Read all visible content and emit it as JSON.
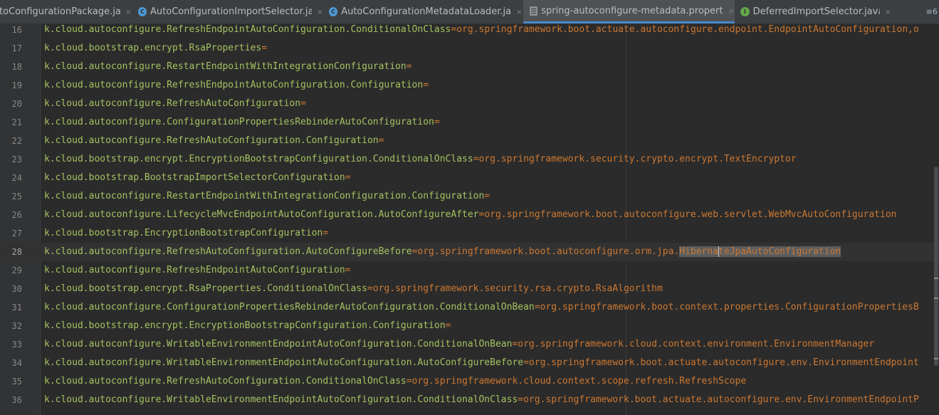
{
  "tabs": [
    {
      "label": "toConfigurationPackage.java",
      "icon": "none",
      "active": false
    },
    {
      "label": "AutoConfigurationImportSelector.java",
      "icon": "class-icon",
      "active": false
    },
    {
      "label": "AutoConfigurationMetadataLoader.java",
      "icon": "class-icon",
      "active": false
    },
    {
      "label": "spring-autoconfigure-metadata.properties",
      "icon": "properties-file-icon",
      "active": true
    },
    {
      "label": "DeferredImportSelector.java",
      "icon": "interface-icon",
      "active": false
    }
  ],
  "tab_close_glyph": "×",
  "tab_overflow_glyph": "≡6",
  "colors": {
    "background": "#2b2b2b",
    "key": "#a5c261",
    "value": "#cc7832",
    "line_number": "#888888",
    "active_tab_underline": "#4a88c7"
  },
  "editor": {
    "current_line": 28,
    "lines": [
      {
        "num": "16",
        "key": "k.cloud.autoconfigure.RefreshEndpointAutoConfiguration.ConditionalOnClass",
        "value": "org.springframework.boot.actuate.autoconfigure.endpoint.EndpointAutoConfiguration,o"
      },
      {
        "num": "17",
        "key": "k.cloud.bootstrap.encrypt.RsaProperties",
        "value": ""
      },
      {
        "num": "18",
        "key": "k.cloud.autoconfigure.RestartEndpointWithIntegrationConfiguration",
        "value": ""
      },
      {
        "num": "19",
        "key": "k.cloud.autoconfigure.RefreshEndpointAutoConfiguration.Configuration",
        "value": ""
      },
      {
        "num": "20",
        "key": "k.cloud.autoconfigure.RefreshAutoConfiguration",
        "value": ""
      },
      {
        "num": "21",
        "key": "k.cloud.autoconfigure.ConfigurationPropertiesRebinderAutoConfiguration",
        "value": ""
      },
      {
        "num": "22",
        "key": "k.cloud.autoconfigure.RefreshAutoConfiguration.Configuration",
        "value": ""
      },
      {
        "num": "23",
        "key": "k.cloud.bootstrap.encrypt.EncryptionBootstrapConfiguration.ConditionalOnClass",
        "value": "org.springframework.security.crypto.encrypt.TextEncryptor"
      },
      {
        "num": "24",
        "key": "k.cloud.bootstrap.BootstrapImportSelectorConfiguration",
        "value": ""
      },
      {
        "num": "25",
        "key": "k.cloud.autoconfigure.RestartEndpointWithIntegrationConfiguration.Configuration",
        "value": ""
      },
      {
        "num": "26",
        "key": "k.cloud.autoconfigure.LifecycleMvcEndpointAutoConfiguration.AutoConfigureAfter",
        "value": "org.springframework.boot.autoconfigure.web.servlet.WebMvcAutoConfiguration"
      },
      {
        "num": "27",
        "key": "k.cloud.bootstrap.EncryptionBootstrapConfiguration",
        "value": ""
      },
      {
        "num": "28",
        "key": "k.cloud.autoconfigure.RefreshAutoConfiguration.AutoConfigureBefore",
        "value": "org.springframework.boot.autoconfigure.orm.jpa.",
        "sel_before": "Hiberna",
        "sel_after": "teJpaAutoConfiguration"
      },
      {
        "num": "29",
        "key": "k.cloud.autoconfigure.RefreshEndpointAutoConfiguration",
        "value": ""
      },
      {
        "num": "30",
        "key": "k.cloud.bootstrap.encrypt.RsaProperties.ConditionalOnClass",
        "value": "org.springframework.security.rsa.crypto.RsaAlgorithm"
      },
      {
        "num": "31",
        "key": "k.cloud.autoconfigure.ConfigurationPropertiesRebinderAutoConfiguration.ConditionalOnBean",
        "value": "org.springframework.boot.context.properties.ConfigurationPropertiesB"
      },
      {
        "num": "32",
        "key": "k.cloud.bootstrap.encrypt.EncryptionBootstrapConfiguration.Configuration",
        "value": ""
      },
      {
        "num": "33",
        "key": "k.cloud.autoconfigure.WritableEnvironmentEndpointAutoConfiguration.ConditionalOnBean",
        "value": "org.springframework.cloud.context.environment.EnvironmentManager"
      },
      {
        "num": "34",
        "key": "k.cloud.autoconfigure.WritableEnvironmentEndpointAutoConfiguration.AutoConfigureBefore",
        "value": "org.springframework.boot.actuate.autoconfigure.env.EnvironmentEndpoint"
      },
      {
        "num": "35",
        "key": "k.cloud.autoconfigure.RefreshAutoConfiguration.ConditionalOnClass",
        "value": "org.springframework.cloud.context.scope.refresh.RefreshScope"
      },
      {
        "num": "36",
        "key": "k.cloud.autoconfigure.WritableEnvironmentEndpointAutoConfiguration.ConditionalOnClass",
        "value": "org.springframework.boot.actuate.autoconfigure.env.EnvironmentEndpointP"
      }
    ]
  }
}
